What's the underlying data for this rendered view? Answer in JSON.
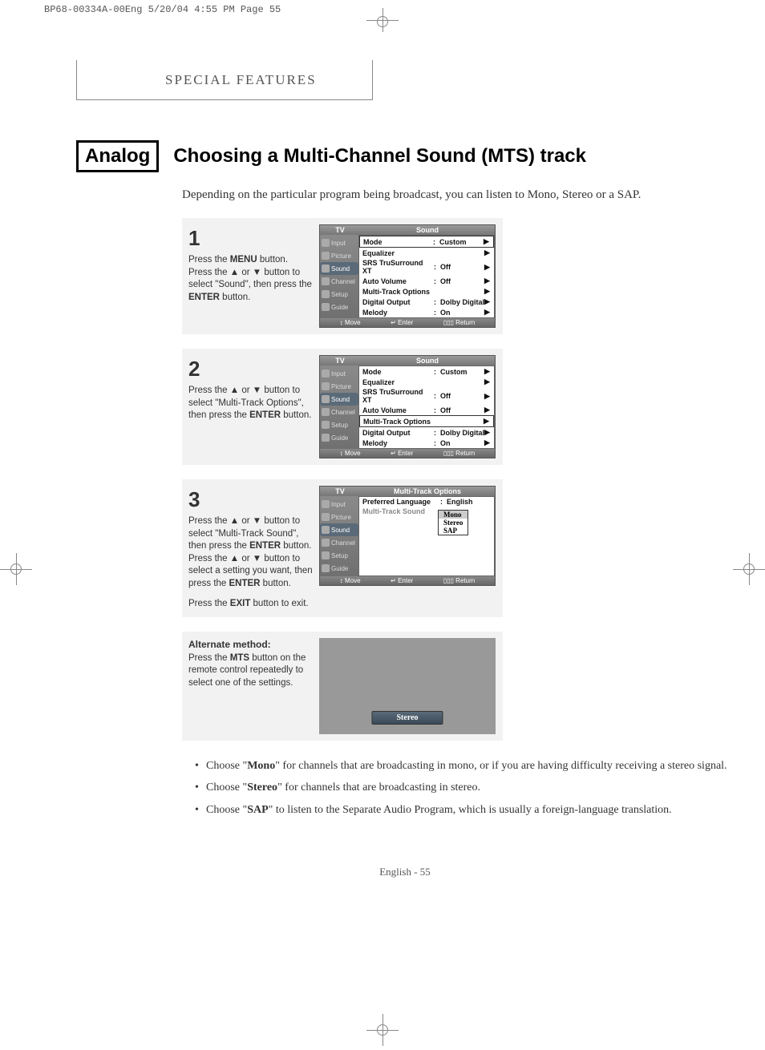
{
  "print_header": "BP68-00334A-00Eng  5/20/04  4:55 PM  Page 55",
  "section_title": "SPECIAL FEATURES",
  "analog_label": "Analog",
  "main_title": "Choosing a Multi-Channel Sound (MTS) track",
  "intro": "Depending on the particular program being broadcast, you can listen to Mono, Stereo or a SAP.",
  "osd_sidebar": [
    "Input",
    "Picture",
    "Sound",
    "Channel",
    "Setup",
    "Guide"
  ],
  "osd_footer": {
    "move": "↕ Move",
    "enter": "↵ Enter",
    "return": "▯▯▯ Return"
  },
  "sound_menu": {
    "tv": "TV",
    "name": "Sound",
    "rows": [
      {
        "label": "Mode",
        "val": "Custom",
        "arr": "▶"
      },
      {
        "label": "Equalizer",
        "val": "",
        "arr": "▶"
      },
      {
        "label": "SRS TruSurround XT",
        "val": "Off",
        "arr": "▶"
      },
      {
        "label": "Auto Volume",
        "val": "Off",
        "arr": "▶"
      },
      {
        "label": "Multi-Track Options",
        "val": "",
        "arr": "▶"
      },
      {
        "label": "Digital Output",
        "val": "Dolby Digital",
        "arr": "▶"
      },
      {
        "label": "Melody",
        "val": "On",
        "arr": "▶"
      }
    ]
  },
  "mt_menu": {
    "tv": "TV",
    "name": "Multi-Track Options",
    "rows": [
      {
        "label": "Preferred Language",
        "val": "English"
      },
      {
        "label": "Multi-Track Sound",
        "val": ""
      }
    ],
    "dropdown": [
      "Mono",
      "Stereo",
      "SAP"
    ]
  },
  "step1": {
    "num": "1",
    "t1": "Press the ",
    "b1": "MENU",
    "t2": " button.",
    "t3": "Press the ▲ or ▼ button to select \"Sound\", then press the ",
    "b2": "ENTER",
    "t4": " button."
  },
  "step2": {
    "num": "2",
    "t1": "Press the ▲ or ▼ button to select \"Multi-Track Options\", then press the ",
    "b1": "ENTER",
    "t2": " button."
  },
  "step3": {
    "num": "3",
    "t1": "Press the ▲ or ▼ button to select \"Multi-Track Sound\", then press the ",
    "b1": "ENTER",
    "t2": " button.",
    "t3": "Press the ▲ or ▼ button to select a setting you want, then press the ",
    "b2": "ENTER",
    "t4": " button.",
    "t5": "Press the ",
    "b3": "EXIT",
    "t6": " button to exit."
  },
  "alt": {
    "title": "Alternate method:",
    "t1": "Press the ",
    "b1": "MTS",
    "t2": " button on the remote control repeatedly to select one of the settings.",
    "bar": "Stereo"
  },
  "bullets": [
    {
      "p1": "Choose \"",
      "b": "Mono",
      "p2": "\" for channels that are broadcasting in mono, or if you are having difficulty receiving a stereo signal."
    },
    {
      "p1": "Choose \"",
      "b": "Stereo",
      "p2": "\" for channels that are broadcasting in stereo."
    },
    {
      "p1": "Choose \"",
      "b": "SAP",
      "p2": "\" to listen to the Separate Audio Program, which is usually a foreign-language translation."
    }
  ],
  "page_foot": "English - 55"
}
